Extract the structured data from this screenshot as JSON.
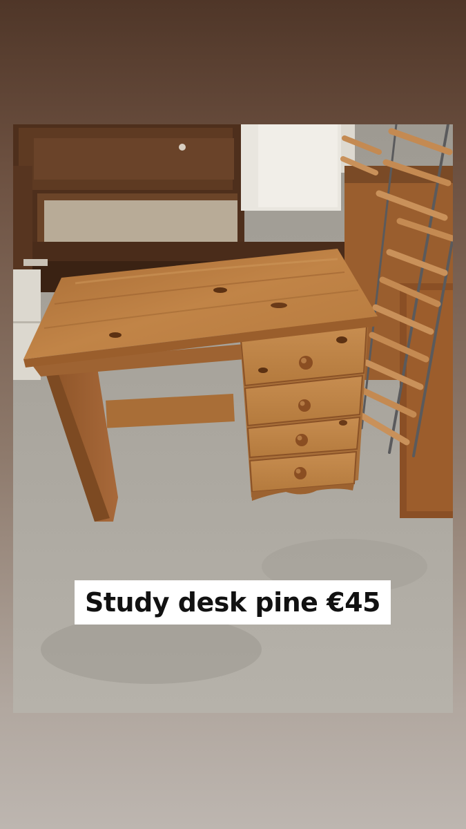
{
  "caption": {
    "text": "Study desk pine €45"
  },
  "colors": {
    "background_top": "#4f3628",
    "background_bottom": "#bdb6b0",
    "caption_bg": "#ffffff",
    "caption_text": "#111111",
    "pine": "#b5793f",
    "carpet": "#a8a49c"
  }
}
